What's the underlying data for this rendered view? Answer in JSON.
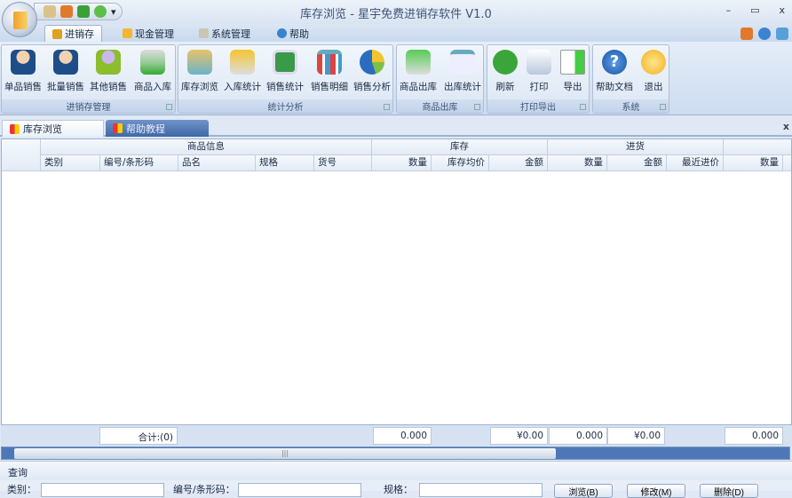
{
  "window": {
    "title": "库存浏览 - 星宇免费进销存软件 V1.0",
    "minimize": "–",
    "maximize": "▭",
    "close": "x",
    "qat_more": "▾"
  },
  "ribbon_tabs": [
    {
      "label": "进销存",
      "active": true
    },
    {
      "label": "现金管理"
    },
    {
      "label": "系统管理"
    },
    {
      "label": "帮助"
    }
  ],
  "groups": [
    {
      "label": "进销存管理",
      "buttons": [
        "单品销售",
        "批量销售",
        "其他销售",
        "商品入库"
      ]
    },
    {
      "label": "统计分析",
      "buttons": [
        "库存浏览",
        "入库统计",
        "销售统计",
        "销售明细",
        "销售分析"
      ]
    },
    {
      "label": "商品出库",
      "buttons": [
        "商品出库",
        "出库统计"
      ]
    },
    {
      "label": "打印导出",
      "buttons": [
        "刷新",
        "打印",
        "导出"
      ]
    },
    {
      "label": "系统",
      "buttons": [
        "帮助文档",
        "退出"
      ]
    }
  ],
  "doc_tabs": [
    {
      "label": "库存浏览",
      "active": true
    },
    {
      "label": "帮助教程"
    }
  ],
  "doc_close": "x",
  "grid": {
    "groups": [
      "商品信息",
      "库存",
      "进货"
    ],
    "columns": [
      "类别",
      "编号/条形码",
      "品名",
      "规格",
      "货号",
      "数量",
      "库存均价",
      "金额",
      "数量",
      "金额",
      "最近进价",
      "数量"
    ],
    "rows": []
  },
  "summary": {
    "count": "合计:(0)",
    "stock_qty": "0.000",
    "stock_amount": "¥0.00",
    "purchase_qty": "0.000",
    "purchase_amount": "¥0.00",
    "last_qty": "0.000"
  },
  "scroll_grip": "|||",
  "query": {
    "title": "查询",
    "category_label": "类别：",
    "code_label": "编号/条形码：",
    "spec_label": "规格：",
    "category_value": "",
    "code_value": "",
    "spec_value": "",
    "browse_button": "浏览(B)",
    "edit_button": "修改(M)",
    "delete_button": "删除(D)"
  }
}
